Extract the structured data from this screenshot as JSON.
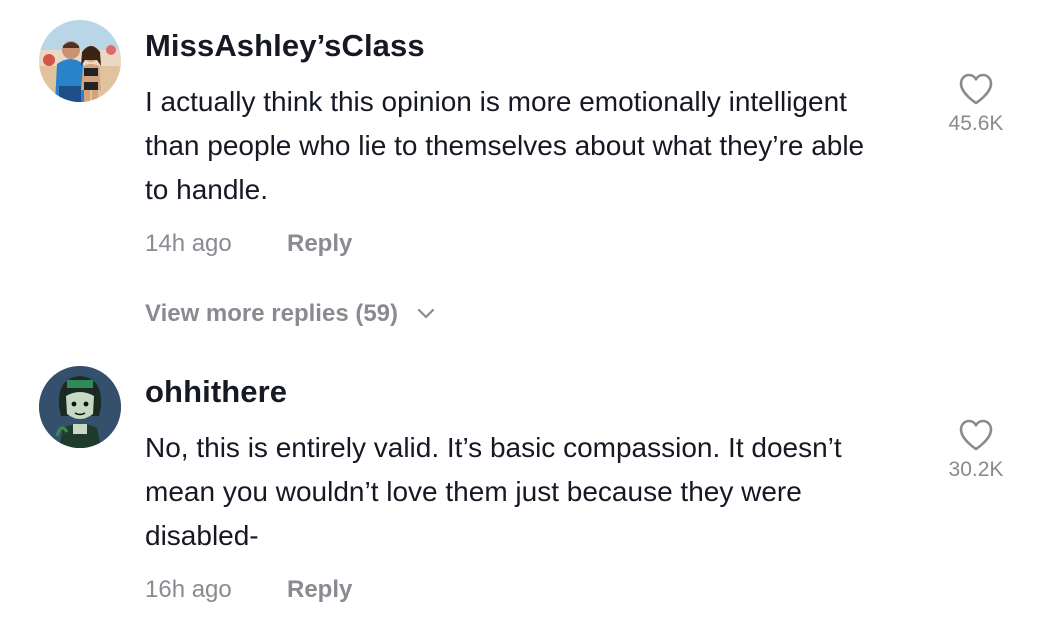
{
  "comments": [
    {
      "username": "MissAshley’sClass",
      "text": "I actually think this opinion is more emotionally intelligent than people who lie to themselves about what they’re able to handle.",
      "time": "14h ago",
      "reply_label": "Reply",
      "likes": "45.6K",
      "avatar_icon": "user-avatar-photo-couple",
      "view_more_label": "View more replies (59)"
    },
    {
      "username": "ohhithere",
      "text": "No, this is entirely valid. It’s basic compassion. It doesn’t mean you wouldn’t love them just because they were disabled-",
      "time": "16h ago",
      "reply_label": "Reply",
      "likes": "30.2K",
      "avatar_icon": "user-avatar-cartoon"
    }
  ],
  "colors": {
    "primary_text": "#161823",
    "secondary_text": "#8a8b91",
    "background": "#ffffff"
  },
  "icons": {
    "like": "heart-outline-icon",
    "expand": "chevron-down-icon"
  }
}
